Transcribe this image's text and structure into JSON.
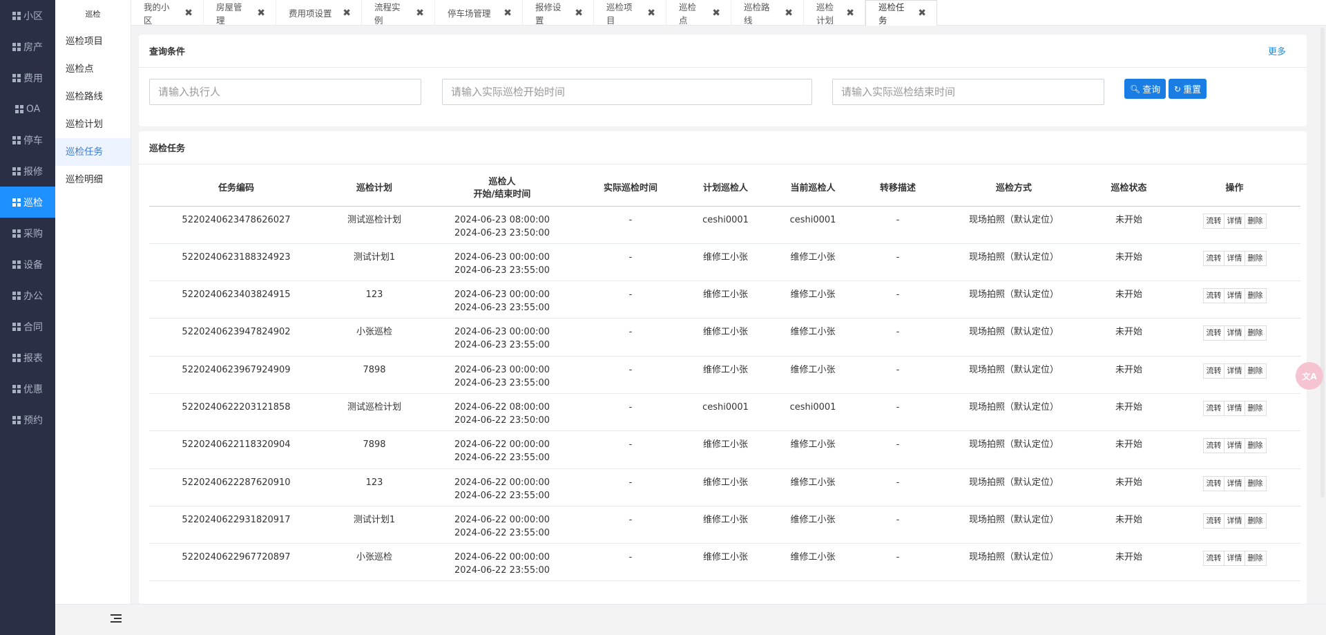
{
  "main_nav": [
    {
      "label": "小区"
    },
    {
      "label": "房产"
    },
    {
      "label": "费用"
    },
    {
      "label": "OA"
    },
    {
      "label": "停车"
    },
    {
      "label": "报修"
    },
    {
      "label": "巡检",
      "active": true
    },
    {
      "label": "采购"
    },
    {
      "label": "设备"
    },
    {
      "label": "办公"
    },
    {
      "label": "合同"
    },
    {
      "label": "报表"
    },
    {
      "label": "优惠"
    },
    {
      "label": "预约"
    }
  ],
  "sub_nav": {
    "header": "巡检",
    "items": [
      {
        "label": "巡检项目"
      },
      {
        "label": "巡检点"
      },
      {
        "label": "巡检路线"
      },
      {
        "label": "巡检计划"
      },
      {
        "label": "巡检任务",
        "active": true
      },
      {
        "label": "巡检明细"
      }
    ]
  },
  "tabs": [
    {
      "label": "我的小区"
    },
    {
      "label": "房屋管理"
    },
    {
      "label": "费用项设置"
    },
    {
      "label": "流程实例"
    },
    {
      "label": "停车场管理"
    },
    {
      "label": "报修设置"
    },
    {
      "label": "巡检项目"
    },
    {
      "label": "巡检点"
    },
    {
      "label": "巡检路线"
    },
    {
      "label": "巡检计划"
    },
    {
      "label": "巡检任务",
      "active": true
    }
  ],
  "query": {
    "title": "查询条件",
    "more": "更多",
    "executor_placeholder": "请输入执行人",
    "start_placeholder": "请输入实际巡检开始时间",
    "end_placeholder": "请输入实际巡检结束时间",
    "search_label": "查询",
    "reset_label": "重置"
  },
  "tasks": {
    "title": "巡检任务",
    "columns": [
      "任务编码",
      "巡检计划",
      "巡检人",
      "开始/结束时间",
      "实际巡检时间",
      "计划巡检人",
      "当前巡检人",
      "转移描述",
      "巡检方式",
      "巡检状态",
      "操作"
    ],
    "actions": [
      "流转",
      "详情",
      "删除"
    ],
    "rows": [
      {
        "code": "5220240623478626027",
        "plan": "测试巡检计划",
        "start": "2024-06-23 08:00:00",
        "end": "2024-06-23 23:50:00",
        "actual": "-",
        "planned": "ceshi0001",
        "current": "ceshi0001",
        "transfer": "-",
        "method": "现场拍照（默认定位）",
        "status": "未开始"
      },
      {
        "code": "5220240623188324923",
        "plan": "测试计划1",
        "start": "2024-06-23 00:00:00",
        "end": "2024-06-23 23:55:00",
        "actual": "-",
        "planned": "维修工小张",
        "current": "维修工小张",
        "transfer": "-",
        "method": "现场拍照（默认定位）",
        "status": "未开始"
      },
      {
        "code": "5220240623403824915",
        "plan": "123",
        "start": "2024-06-23 00:00:00",
        "end": "2024-06-23 23:55:00",
        "actual": "-",
        "planned": "维修工小张",
        "current": "维修工小张",
        "transfer": "-",
        "method": "现场拍照（默认定位）",
        "status": "未开始"
      },
      {
        "code": "5220240623947824902",
        "plan": "小张巡检",
        "start": "2024-06-23 00:00:00",
        "end": "2024-06-23 23:55:00",
        "actual": "-",
        "planned": "维修工小张",
        "current": "维修工小张",
        "transfer": "-",
        "method": "现场拍照（默认定位）",
        "status": "未开始"
      },
      {
        "code": "5220240623967924909",
        "plan": "7898",
        "start": "2024-06-23 00:00:00",
        "end": "2024-06-23 23:55:00",
        "actual": "-",
        "planned": "维修工小张",
        "current": "维修工小张",
        "transfer": "-",
        "method": "现场拍照（默认定位）",
        "status": "未开始"
      },
      {
        "code": "5220240622203121858",
        "plan": "测试巡检计划",
        "start": "2024-06-22 08:00:00",
        "end": "2024-06-22 23:50:00",
        "actual": "-",
        "planned": "ceshi0001",
        "current": "ceshi0001",
        "transfer": "-",
        "method": "现场拍照（默认定位）",
        "status": "未开始"
      },
      {
        "code": "5220240622118320904",
        "plan": "7898",
        "start": "2024-06-22 00:00:00",
        "end": "2024-06-22 23:55:00",
        "actual": "-",
        "planned": "维修工小张",
        "current": "维修工小张",
        "transfer": "-",
        "method": "现场拍照（默认定位）",
        "status": "未开始"
      },
      {
        "code": "5220240622287620910",
        "plan": "123",
        "start": "2024-06-22 00:00:00",
        "end": "2024-06-22 23:55:00",
        "actual": "-",
        "planned": "维修工小张",
        "current": "维修工小张",
        "transfer": "-",
        "method": "现场拍照（默认定位）",
        "status": "未开始"
      },
      {
        "code": "5220240622931820917",
        "plan": "测试计划1",
        "start": "2024-06-22 00:00:00",
        "end": "2024-06-22 23:55:00",
        "actual": "-",
        "planned": "维修工小张",
        "current": "维修工小张",
        "transfer": "-",
        "method": "现场拍照（默认定位）",
        "status": "未开始"
      },
      {
        "code": "5220240622967720897",
        "plan": "小张巡检",
        "start": "2024-06-22 00:00:00",
        "end": "2024-06-22 23:55:00",
        "actual": "-",
        "planned": "维修工小张",
        "current": "维修工小张",
        "transfer": "-",
        "method": "现场拍照（默认定位）",
        "status": "未开始"
      }
    ]
  },
  "floating_widget": {
    "icon": "translate-icon",
    "text": "文A"
  }
}
